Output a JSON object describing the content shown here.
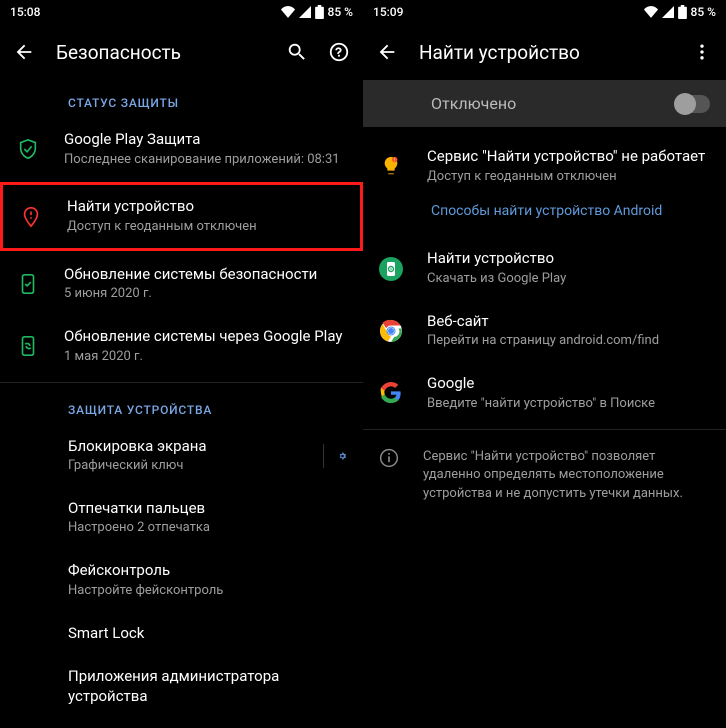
{
  "left": {
    "time": "15:08",
    "battery": "85 %",
    "title": "Безопасность",
    "section_status": "СТАТУС ЗАЩИТЫ",
    "play_protect": {
      "title": "Google Play Защита",
      "summary": "Последнее сканирование приложений: 08:31"
    },
    "find_device": {
      "title": "Найти устройство",
      "summary": "Доступ к геоданным отключен"
    },
    "security_update": {
      "title": "Обновление системы безопасности",
      "summary": "5 июня 2020 г."
    },
    "gp_system_update": {
      "title": "Обновление системы через Google Play",
      "summary": "1 мая 2020 г."
    },
    "section_device": "ЗАЩИТА УСТРОЙСТВА",
    "screen_lock": {
      "title": "Блокировка экрана",
      "summary": "Графический ключ"
    },
    "fingerprints": {
      "title": "Отпечатки пальцев",
      "summary": "Настроено 2 отпечатка"
    },
    "face": {
      "title": "Фейсконтроль",
      "summary": "Настройте фейсконтроль"
    },
    "smart_lock": {
      "title": "Smart Lock"
    },
    "admin_apps": {
      "title": "Приложения администратора устройства"
    }
  },
  "right": {
    "time": "15:09",
    "battery": "85 %",
    "title": "Найти устройство",
    "switch_label": "Отключено",
    "warning": {
      "title": "Сервис \"Найти устройство\" не работает",
      "summary": "Доступ к геоданным отключен"
    },
    "link": "Способы найти устройство Android",
    "find_app": {
      "title": "Найти устройство",
      "summary": "Скачать из Google Play"
    },
    "website": {
      "title": "Веб-сайт",
      "summary": "Перейти на страницу android.com/find"
    },
    "google": {
      "title": "Google",
      "summary": "Введите \"найти устройство\" в Поиске"
    },
    "info": "Сервис \"Найти устройство\" позволяет удаленно определять местоположение устройства и не допустить утечки данных."
  }
}
